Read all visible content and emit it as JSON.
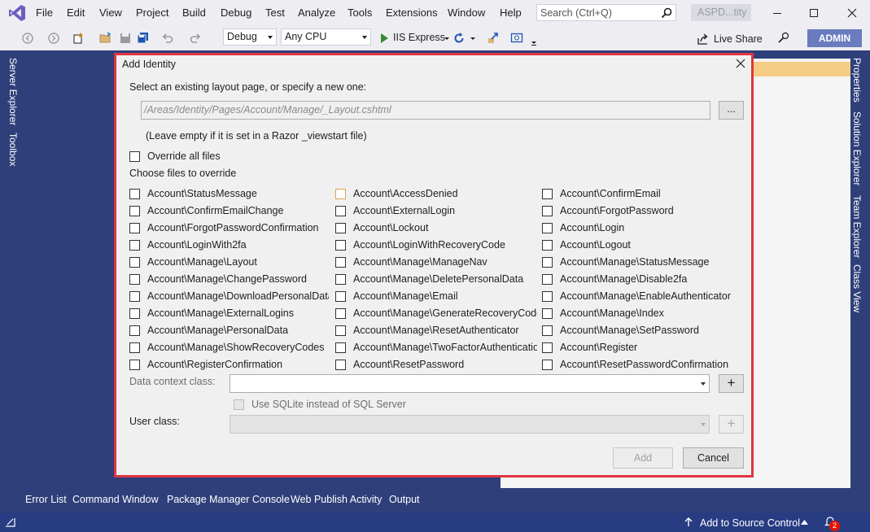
{
  "menu": {
    "items": [
      "File",
      "Edit",
      "View",
      "Project",
      "Build",
      "Debug",
      "Test",
      "Analyze",
      "Tools",
      "Extensions",
      "Window",
      "Help"
    ],
    "search_placeholder": "Search (Ctrl+Q)",
    "solution_name": "ASPD...tity"
  },
  "toolbar": {
    "configuration": "Debug",
    "platform": "Any CPU",
    "run_target": "IIS Express",
    "live_share": "Live Share",
    "user": "ADMIN"
  },
  "side_tabs": {
    "left": [
      "Server Explorer",
      "Toolbox"
    ],
    "right": [
      "Properties",
      "Solution Explorer",
      "Team Explorer",
      "Class View"
    ]
  },
  "bottom_tabs": [
    "Error List",
    "Command Window",
    "Package Manager Console",
    "Web Publish Activity",
    "Output"
  ],
  "status": {
    "source_control": "Add to Source Control",
    "notifications": "2"
  },
  "dialog": {
    "title": "Add Identity",
    "layout_prompt": "Select an existing layout page, or specify a new one:",
    "layout_value": "/Areas/Identity/Pages/Account/Manage/_Layout.cshtml",
    "browse_label": "...",
    "layout_hint": "(Leave empty if it is set in a Razor _viewstart file)",
    "override_all_label": "Override all files",
    "choose_files_label": "Choose files to override",
    "files_col1": [
      "Account\\StatusMessage",
      "Account\\ConfirmEmailChange",
      "Account\\ForgotPasswordConfirmation",
      "Account\\LoginWith2fa",
      "Account\\Manage\\Layout",
      "Account\\Manage\\ChangePassword",
      "Account\\Manage\\DownloadPersonalData",
      "Account\\Manage\\ExternalLogins",
      "Account\\Manage\\PersonalData",
      "Account\\Manage\\ShowRecoveryCodes",
      "Account\\RegisterConfirmation"
    ],
    "files_col2": [
      "Account\\AccessDenied",
      "Account\\ExternalLogin",
      "Account\\Lockout",
      "Account\\LoginWithRecoveryCode",
      "Account\\Manage\\ManageNav",
      "Account\\Manage\\DeletePersonalData",
      "Account\\Manage\\Email",
      "Account\\Manage\\GenerateRecoveryCodes",
      "Account\\Manage\\ResetAuthenticator",
      "Account\\Manage\\TwoFactorAuthentication",
      "Account\\ResetPassword"
    ],
    "files_col3": [
      "Account\\ConfirmEmail",
      "Account\\ForgotPassword",
      "Account\\Login",
      "Account\\Logout",
      "Account\\Manage\\StatusMessage",
      "Account\\Manage\\Disable2fa",
      "Account\\Manage\\EnableAuthenticator",
      "Account\\Manage\\Index",
      "Account\\Manage\\SetPassword",
      "Account\\Register",
      "Account\\ResetPasswordConfirmation"
    ],
    "data_context_label": "Data context class:",
    "data_context_value": "",
    "sqlite_label": "Use SQLite instead of SQL Server",
    "user_class_label": "User class:",
    "user_class_value": "",
    "add_label": "Add",
    "cancel_label": "Cancel",
    "plus_label": "+"
  },
  "colors": {
    "ide_background": "#2e3f7a",
    "chrome": "#eeeef2",
    "dialog_outline": "#e0353f",
    "run_green": "#388a34",
    "admin_badge": "#6a7bbf"
  }
}
